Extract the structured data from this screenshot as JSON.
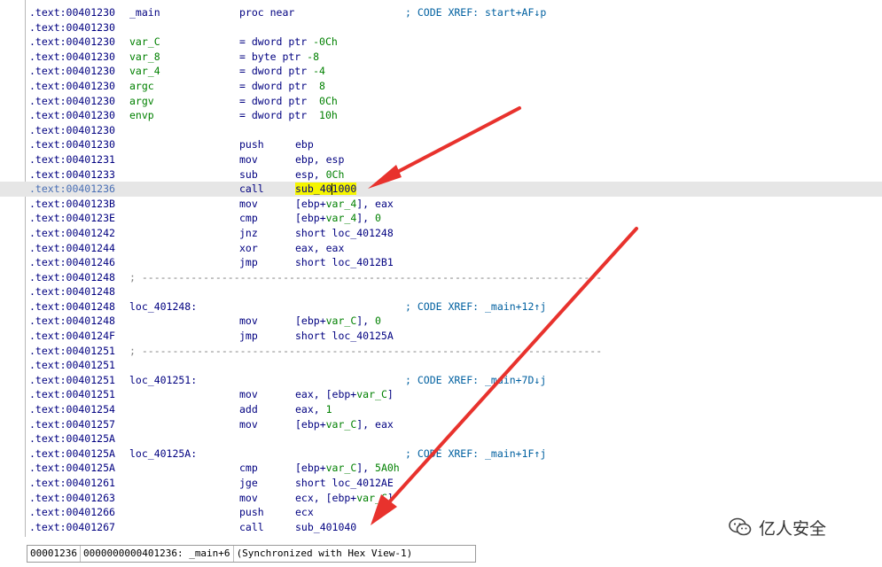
{
  "lines": [
    {
      "addr": ".text:00401230",
      "label": "_main",
      "eq": "proc near",
      "comment": "; CODE XREF: start+AF↓p"
    },
    {
      "addr": ".text:00401230"
    },
    {
      "addr": ".text:00401230",
      "label": "var_C",
      "eq_pre": "= dword ptr ",
      "eq_num": "-0Ch"
    },
    {
      "addr": ".text:00401230",
      "label": "var_8",
      "eq_pre": "= byte ptr ",
      "eq_num": "-8"
    },
    {
      "addr": ".text:00401230",
      "label": "var_4",
      "eq_pre": "= dword ptr ",
      "eq_num": "-4"
    },
    {
      "addr": ".text:00401230",
      "label": "argc",
      "eq_pre": "= dword ptr  ",
      "eq_num": "8"
    },
    {
      "addr": ".text:00401230",
      "label": "argv",
      "eq_pre": "= dword ptr  ",
      "eq_num": "0Ch"
    },
    {
      "addr": ".text:00401230",
      "label": "envp",
      "eq_pre": "= dword ptr  ",
      "eq_num": "10h"
    },
    {
      "addr": ".text:00401230"
    },
    {
      "addr": ".text:00401230",
      "mn": "push",
      "op": "ebp"
    },
    {
      "addr": ".text:00401231",
      "mn": "mov",
      "op": "ebp, esp"
    },
    {
      "addr": ".text:00401233",
      "mn": "sub",
      "op_pre": "esp, ",
      "op_num": "0Ch"
    },
    {
      "addr": ".text:00401236",
      "mn": "call",
      "call_a": "sub_40",
      "call_b": "1000",
      "highlight": true
    },
    {
      "addr": ".text:0040123B",
      "mn": "mov",
      "op_pre": "[ebp+",
      "op_var": "var_4",
      "op_post": "], eax"
    },
    {
      "addr": ".text:0040123E",
      "mn": "cmp",
      "op_pre": "[ebp+",
      "op_var": "var_4",
      "op_post": "], ",
      "op_num": "0"
    },
    {
      "addr": ".text:00401242",
      "mn": "jnz",
      "op": "short loc_401248"
    },
    {
      "addr": ".text:00401244",
      "mn": "xor",
      "op": "eax, eax"
    },
    {
      "addr": ".text:00401246",
      "mn": "jmp",
      "op": "short loc_4012B1"
    },
    {
      "addr": ".text:00401248",
      "sep": "; ---------------------------------------------------------------------------"
    },
    {
      "addr": ".text:00401248"
    },
    {
      "addr": ".text:00401248",
      "label": "loc_401248:",
      "comment": "; CODE XREF: _main+12↑j"
    },
    {
      "addr": ".text:00401248",
      "mn": "mov",
      "op_pre": "[ebp+",
      "op_var": "var_C",
      "op_post": "], ",
      "op_num": "0"
    },
    {
      "addr": ".text:0040124F",
      "mn": "jmp",
      "op": "short loc_40125A"
    },
    {
      "addr": ".text:00401251",
      "sep": "; ---------------------------------------------------------------------------"
    },
    {
      "addr": ".text:00401251"
    },
    {
      "addr": ".text:00401251",
      "label": "loc_401251:",
      "comment": "; CODE XREF: _main+7D↓j"
    },
    {
      "addr": ".text:00401251",
      "mn": "mov",
      "op_pre": "eax, [ebp+",
      "op_var": "var_C",
      "op_post": "]"
    },
    {
      "addr": ".text:00401254",
      "mn": "add",
      "op_pre": "eax, ",
      "op_num": "1"
    },
    {
      "addr": ".text:00401257",
      "mn": "mov",
      "op_pre": "[ebp+",
      "op_var": "var_C",
      "op_post": "], eax"
    },
    {
      "addr": ".text:0040125A"
    },
    {
      "addr": ".text:0040125A",
      "label": "loc_40125A:",
      "comment": "; CODE XREF: _main+1F↑j"
    },
    {
      "addr": ".text:0040125A",
      "mn": "cmp",
      "op_pre": "[ebp+",
      "op_var": "var_C",
      "op_post": "], ",
      "op_num": "5A0h"
    },
    {
      "addr": ".text:00401261",
      "mn": "jge",
      "op": "short loc_4012AE"
    },
    {
      "addr": ".text:00401263",
      "mn": "mov",
      "op_pre": "ecx, [ebp+",
      "op_var": "var_C",
      "op_post": "]"
    },
    {
      "addr": ".text:00401266",
      "mn": "push",
      "op": "ecx"
    },
    {
      "addr": ".text:00401267",
      "mn": "call",
      "op": "sub_401040"
    }
  ],
  "status": {
    "offset": "00001236",
    "address": "0000000000401236: _main+6",
    "sync": "(Synchronized with Hex View-1)"
  },
  "watermark": {
    "text": "亿人安全",
    "icon": "wechat-icon"
  },
  "colors": {
    "background": "#ffffff",
    "code_text": "#000080",
    "var_green": "#008000",
    "comment_blue": "#0060a0",
    "highlight_line": "#e6e6e6",
    "highlight_name": "#f5f500",
    "arrow_red": "#e8322d"
  }
}
